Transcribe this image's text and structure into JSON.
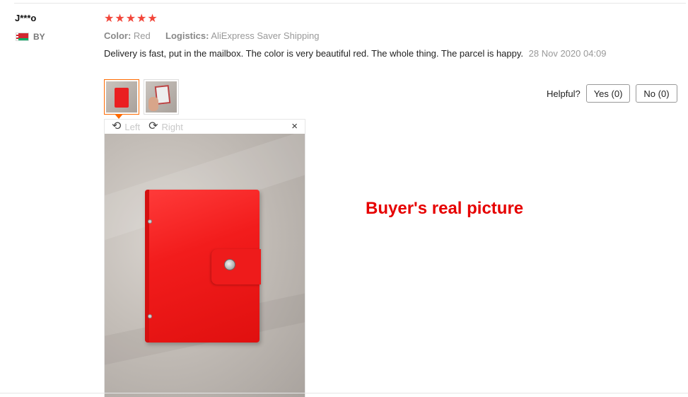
{
  "review": {
    "user_name": "J***o",
    "country_code": "BY",
    "rating": 5,
    "stars": [
      "★",
      "★",
      "★",
      "★",
      "★"
    ],
    "color_label": "Color:",
    "color_value": "Red",
    "logistics_label": "Logistics:",
    "logistics_value": "AliExpress Saver Shipping",
    "text": "Delivery is fast, put in the mailbox. The color is very beautiful red. The whole thing. The parcel is happy.",
    "date": "28 Nov 2020 04:09"
  },
  "viewer": {
    "rotate_left_label": "Left",
    "rotate_right_label": "Right",
    "close_symbol": "×",
    "rotate_left_symbol": "⟲",
    "rotate_right_symbol": "⟳"
  },
  "helpful": {
    "label": "Helpful?",
    "yes_label": "Yes (0)",
    "no_label": "No (0)"
  },
  "caption": "Buyer's real picture",
  "colors": {
    "star": "#f2463a",
    "accent": "#ff6a00",
    "caption": "#e60000"
  }
}
